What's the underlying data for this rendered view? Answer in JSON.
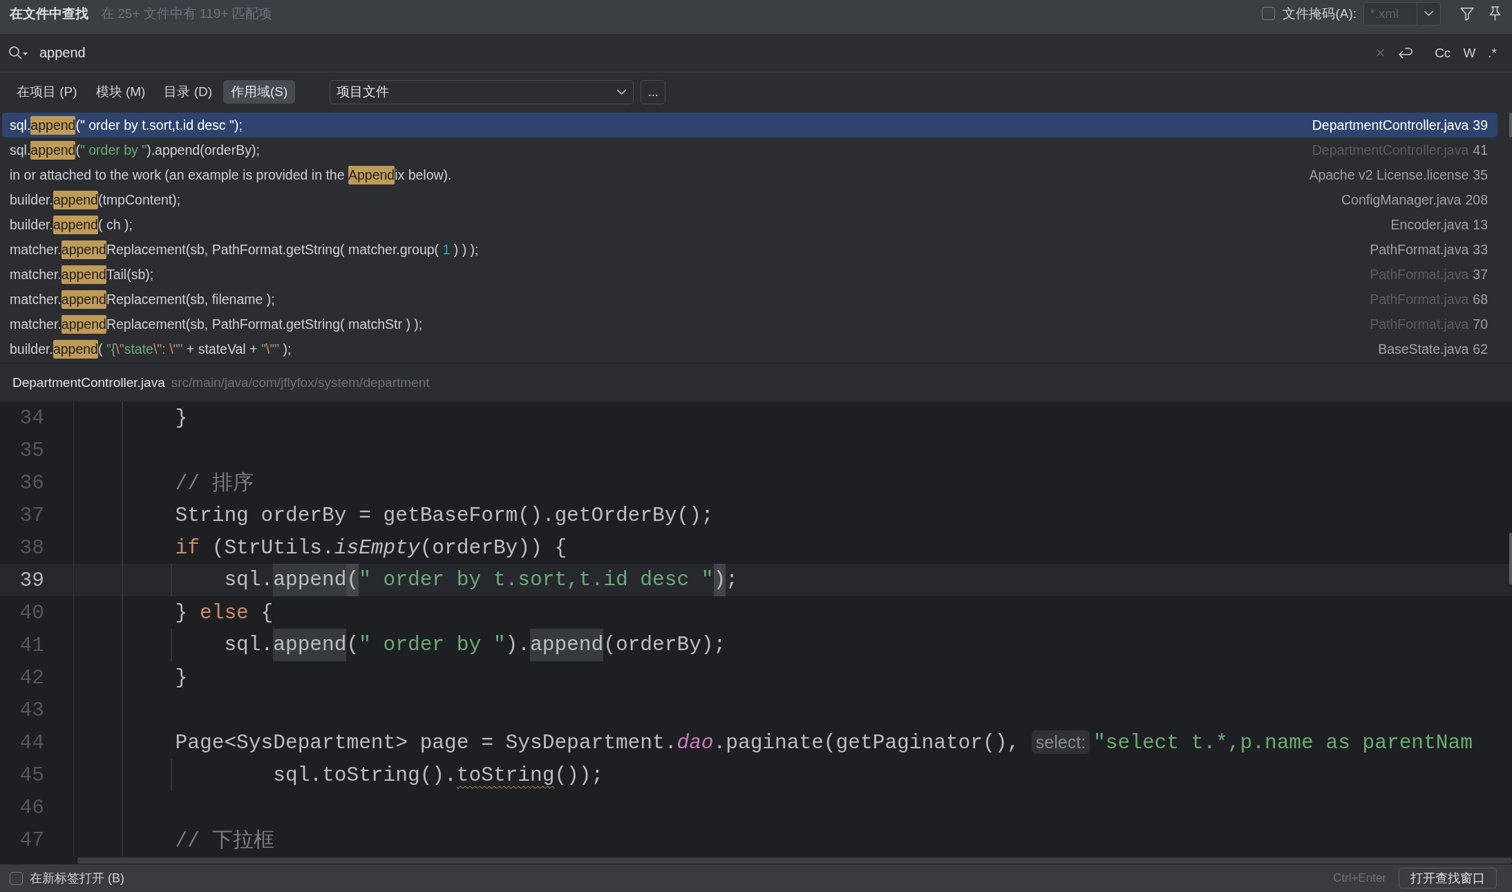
{
  "header": {
    "title": "在文件中查找",
    "summary": "在 25+ 文件中有 119+ 匹配项",
    "file_mask": {
      "checked": false,
      "label": "文件掩码(A):",
      "value": "*.xml"
    }
  },
  "search": {
    "value": "append",
    "options": [
      {
        "label": "Cc",
        "on": false
      },
      {
        "label": "W",
        "on": false
      },
      {
        "label": ".*",
        "on": false
      }
    ]
  },
  "scope": {
    "tabs": [
      {
        "label": "在项目 (P)",
        "selected": false
      },
      {
        "label": "模块 (M)",
        "selected": false
      },
      {
        "label": "目录 (D)",
        "selected": false
      },
      {
        "label": "作用域(S)",
        "selected": true
      }
    ],
    "dropdown": "项目文件",
    "more_button": "..."
  },
  "results": [
    {
      "selected": true,
      "snippet": [
        {
          "kind": "plain",
          "text": "sql."
        },
        {
          "kind": "match",
          "text": "append"
        },
        {
          "kind": "plain",
          "text": "("
        },
        {
          "kind": "string",
          "text": "\" order by t.sort,t.id desc \""
        },
        {
          "kind": "plain",
          "text": ");"
        }
      ],
      "file": "DepartmentController.java",
      "line": "39",
      "muted": false
    },
    {
      "selected": false,
      "snippet": [
        {
          "kind": "plain",
          "text": "sql."
        },
        {
          "kind": "match",
          "text": "append"
        },
        {
          "kind": "plain",
          "text": "("
        },
        {
          "kind": "string",
          "text": "\" order by \""
        },
        {
          "kind": "plain",
          "text": ").append(orderBy);"
        }
      ],
      "file": "DepartmentController.java",
      "line": "41",
      "muted": true
    },
    {
      "selected": false,
      "snippet": [
        {
          "kind": "plain",
          "text": "in or attached to the work (an example is provided in the "
        },
        {
          "kind": "match",
          "text": "Append"
        },
        {
          "kind": "plain",
          "text": "ix below)."
        }
      ],
      "file": "Apache v2 License.license",
      "line": "35",
      "muted": false
    },
    {
      "selected": false,
      "snippet": [
        {
          "kind": "plain",
          "text": "builder."
        },
        {
          "kind": "match",
          "text": "append"
        },
        {
          "kind": "plain",
          "text": "(tmpContent);"
        }
      ],
      "file": "ConfigManager.java",
      "line": "208",
      "muted": false
    },
    {
      "selected": false,
      "snippet": [
        {
          "kind": "plain",
          "text": "builder."
        },
        {
          "kind": "match",
          "text": "append"
        },
        {
          "kind": "plain",
          "text": "( ch );"
        }
      ],
      "file": "Encoder.java",
      "line": "13",
      "muted": false
    },
    {
      "selected": false,
      "snippet": [
        {
          "kind": "plain",
          "text": "matcher."
        },
        {
          "kind": "match",
          "text": "append"
        },
        {
          "kind": "plain",
          "text": "Replacement(sb, PathFormat.getString( matcher.group( "
        },
        {
          "kind": "number",
          "text": "1"
        },
        {
          "kind": "plain",
          "text": " ) ) );"
        }
      ],
      "file": "PathFormat.java",
      "line": "33",
      "muted": false
    },
    {
      "selected": false,
      "snippet": [
        {
          "kind": "plain",
          "text": "matcher."
        },
        {
          "kind": "match",
          "text": "append"
        },
        {
          "kind": "plain",
          "text": "Tail(sb);"
        }
      ],
      "file": "PathFormat.java",
      "line": "37",
      "muted": true
    },
    {
      "selected": false,
      "snippet": [
        {
          "kind": "plain",
          "text": "matcher."
        },
        {
          "kind": "match",
          "text": "append"
        },
        {
          "kind": "plain",
          "text": "Replacement(sb, filename );"
        }
      ],
      "file": "PathFormat.java",
      "line": "68",
      "muted": true
    },
    {
      "selected": false,
      "snippet": [
        {
          "kind": "plain",
          "text": "matcher."
        },
        {
          "kind": "match",
          "text": "append"
        },
        {
          "kind": "plain",
          "text": "Replacement(sb, PathFormat.getString( matchStr ) );"
        }
      ],
      "file": "PathFormat.java",
      "line": "70",
      "muted": true
    },
    {
      "selected": false,
      "snippet": [
        {
          "kind": "plain",
          "text": "builder."
        },
        {
          "kind": "match",
          "text": "append"
        },
        {
          "kind": "plain",
          "text": "( "
        },
        {
          "kind": "string",
          "text": "\"{"
        },
        {
          "kind": "escape",
          "text": "\\\""
        },
        {
          "kind": "string",
          "text": "state"
        },
        {
          "kind": "escape",
          "text": "\\\""
        },
        {
          "kind": "string",
          "text": ": "
        },
        {
          "kind": "escape",
          "text": "\\\""
        },
        {
          "kind": "string",
          "text": "\""
        },
        {
          "kind": "plain",
          "text": " + stateVal + "
        },
        {
          "kind": "string",
          "text": "\""
        },
        {
          "kind": "escape",
          "text": "\\\""
        },
        {
          "kind": "string",
          "text": "\""
        },
        {
          "kind": "plain",
          "text": " );"
        }
      ],
      "file": "BaseState.java",
      "line": "62",
      "muted": false
    }
  ],
  "preview": {
    "file": "DepartmentController.java",
    "path": "src/main/java/com/jflyfox/system/department",
    "lines": [
      {
        "number": "34",
        "current": false,
        "segments": [
          {
            "kind": "plain",
            "text": "        }"
          }
        ]
      },
      {
        "number": "35",
        "current": false
      },
      {
        "number": "36",
        "current": false,
        "segments": [
          {
            "kind": "comment",
            "text": "        // 排序"
          }
        ]
      },
      {
        "number": "37",
        "current": false,
        "segments": [
          {
            "kind": "plain",
            "text": "        String orderBy = getBaseForm().getOrderBy();"
          }
        ]
      },
      {
        "number": "38",
        "current": false,
        "segments": [
          {
            "kind": "keyword",
            "text": "        if"
          },
          {
            "kind": "plain",
            "text": " (StrUtils."
          },
          {
            "kind": "italic",
            "text": "isEmpty"
          },
          {
            "kind": "plain",
            "text": "(orderBy)) {"
          }
        ]
      },
      {
        "number": "39",
        "current": true,
        "segments": [
          {
            "kind": "plain",
            "text": "            sql."
          },
          {
            "kind": "occurrence",
            "text": "append"
          },
          {
            "kind": "brace",
            "text": "("
          },
          {
            "kind": "string",
            "text": "\" order by t.sort,t.id desc \""
          },
          {
            "kind": "brace",
            "text": ")"
          },
          {
            "kind": "plain",
            "text": ";"
          }
        ]
      },
      {
        "number": "40",
        "current": false,
        "segments": [
          {
            "kind": "plain",
            "text": "        } "
          },
          {
            "kind": "keyword",
            "text": "else"
          },
          {
            "kind": "plain",
            "text": " {"
          }
        ]
      },
      {
        "number": "41",
        "current": false,
        "segments": [
          {
            "kind": "plain",
            "text": "            sql."
          },
          {
            "kind": "occurrence",
            "text": "append"
          },
          {
            "kind": "plain",
            "text": "("
          },
          {
            "kind": "string",
            "text": "\" order by \""
          },
          {
            "kind": "plain",
            "text": ")."
          },
          {
            "kind": "occurrence",
            "text": "append"
          },
          {
            "kind": "plain",
            "text": "(orderBy);"
          }
        ]
      },
      {
        "number": "42",
        "current": false,
        "segments": [
          {
            "kind": "plain",
            "text": "        }"
          }
        ]
      },
      {
        "number": "43",
        "current": false
      },
      {
        "number": "44",
        "current": false,
        "segments": [
          {
            "kind": "plain",
            "text": "        Page<SysDepartment> page = SysDepartment."
          },
          {
            "kind": "field",
            "text": "dao"
          },
          {
            "kind": "plain",
            "text": ".paginate(getPaginator(), "
          },
          {
            "kind": "hint",
            "text": "select:"
          },
          {
            "kind": "string",
            "text": "\"select t.*,p.name as parentNam"
          }
        ]
      },
      {
        "number": "45",
        "current": false,
        "segments": [
          {
            "kind": "plain",
            "text": "                sql.toString()."
          },
          {
            "kind": "warning",
            "text": "toString"
          },
          {
            "kind": "plain",
            "text": "());"
          }
        ]
      },
      {
        "number": "46",
        "current": false
      },
      {
        "number": "47",
        "current": false,
        "segments": [
          {
            "kind": "comment",
            "text": "        // 下拉框"
          }
        ]
      }
    ]
  },
  "footer": {
    "new_tab": {
      "label": "在新标签打开 (B)",
      "checked": false
    },
    "shortcut": "Ctrl+Enter",
    "button": "打开查找窗口"
  }
}
